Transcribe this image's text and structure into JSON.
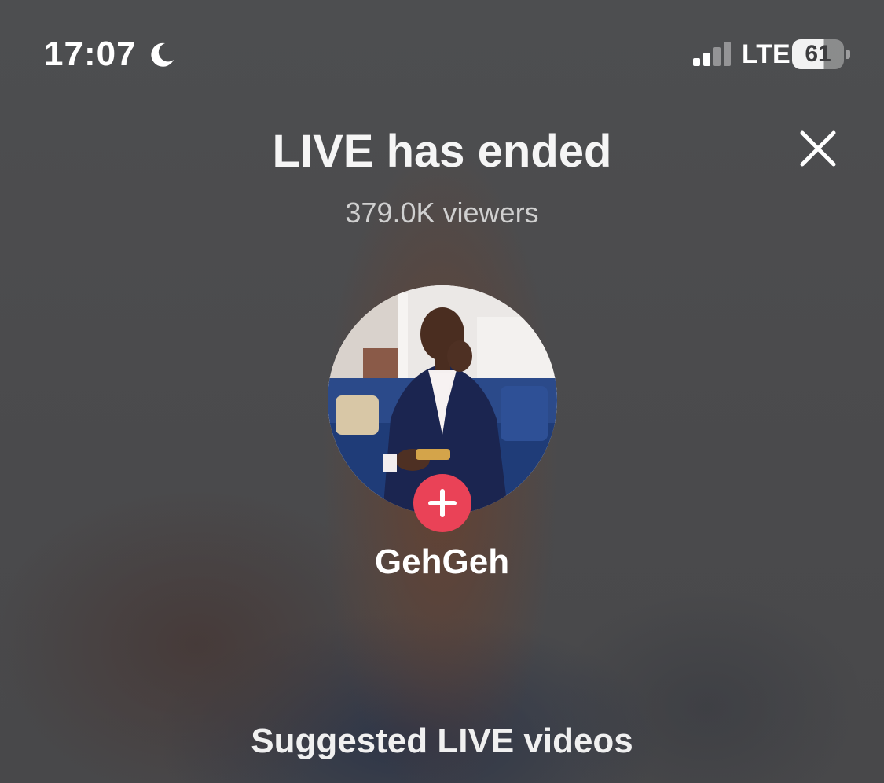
{
  "status_bar": {
    "time": "17:07",
    "moon_icon": "moon-icon",
    "signal_icon": "cellular-signal-icon",
    "network": "LTE",
    "battery_level": "61",
    "battery_icon": "battery-icon"
  },
  "header": {
    "title": "LIVE has ended",
    "close_icon": "close-icon",
    "viewers": "379.0K viewers"
  },
  "profile": {
    "avatar": "avatar-photo",
    "follow_icon": "plus-icon",
    "username": "GehGeh"
  },
  "suggested": {
    "heading": "Suggested LIVE videos"
  },
  "colors": {
    "follow_button": "#ea4257",
    "text_primary": "#ffffff",
    "text_secondary": "#d0d0d0"
  }
}
